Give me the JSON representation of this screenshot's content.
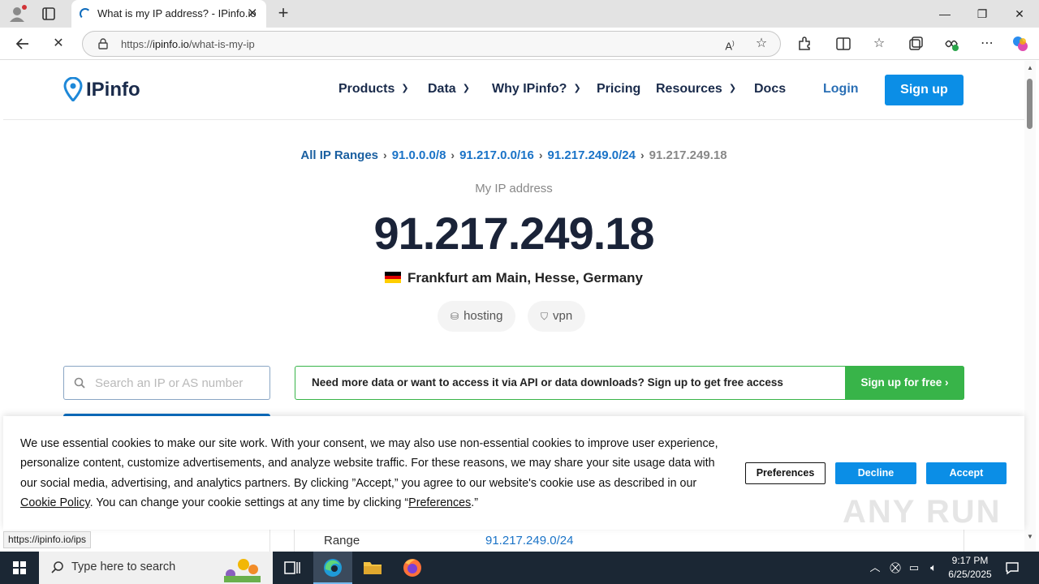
{
  "browser": {
    "tab_title": "What is my IP address? - IPinfo.io",
    "url_prefix": "https://",
    "url_domain": "ipinfo.io",
    "url_path": "/what-is-my-ip",
    "status_url": "https://ipinfo.io/ips"
  },
  "header": {
    "logo_text": "IPinfo",
    "nav": {
      "products": "Products",
      "data": "Data",
      "why": "Why IPinfo?",
      "pricing": "Pricing",
      "resources": "Resources",
      "docs": "Docs"
    },
    "login": "Login",
    "signup": "Sign up"
  },
  "breadcrumb": {
    "all": "All IP Ranges",
    "r1": "91.0.0.0/8",
    "r2": "91.217.0.0/16",
    "r3": "91.217.249.0/24",
    "current": "91.217.249.18"
  },
  "hero": {
    "label": "My IP address",
    "ip": "91.217.249.18",
    "location": "Frankfurt am Main, Hesse, Germany",
    "tags": [
      "hosting",
      "vpn"
    ]
  },
  "search": {
    "placeholder": "Search an IP or AS number"
  },
  "cta": {
    "text": "Need more data or want to access it via API or data downloads? Sign up to get free access",
    "button": "Sign up for free ›"
  },
  "table": {
    "range_label": "Range",
    "range_value": "91.217.249.0/24"
  },
  "cookie": {
    "text_1": "We use essential cookies to make our site work. With your consent, we may also use non-essential cookies to improve user experience, personalize content, customize advertisements, and analyze website traffic. For these reasons, we may share your site usage data with our social media, advertising, and analytics partners. By clicking ”Accept,” you agree to our website's cookie use as described in our ",
    "link_1": "Cookie Policy",
    "text_2": ". You can change your cookie settings at any time by clicking “",
    "link_2": "Preferences",
    "text_3": ".”",
    "preferences": "Preferences",
    "decline": "Decline",
    "accept": "Accept"
  },
  "watermark": "ANY RUN",
  "taskbar": {
    "search_text": "Type here to search",
    "time": "9:17 PM",
    "date": "6/25/2025"
  },
  "colors": {
    "accent_blue": "#0b8ee6",
    "cta_green": "#38b449",
    "link_blue": "#1a73c7"
  }
}
